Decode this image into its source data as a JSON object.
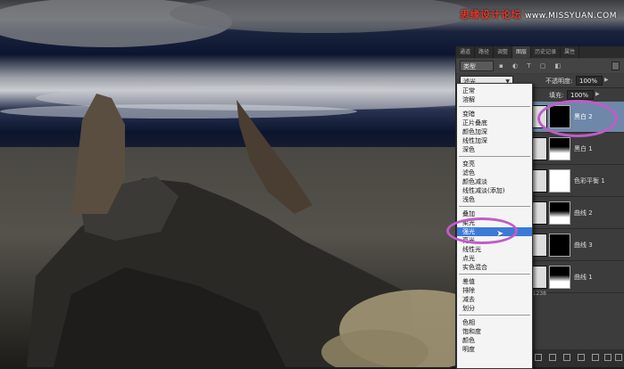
{
  "watermark": {
    "text": "思缘设计论坛",
    "url": "www.MISSYUAN.COM"
  },
  "panel": {
    "tabs": [
      "通道",
      "路径",
      "调整",
      "图层",
      "历史记录",
      "属性"
    ],
    "active_tab_index": 3,
    "filter": {
      "value": "类型"
    },
    "blend_mode": {
      "value": "滤光"
    },
    "opacity": {
      "label": "不透明度:",
      "value": "100%"
    },
    "fill": {
      "label": "填充:",
      "value": "100%"
    },
    "layers": [
      {
        "name": "黑白 2",
        "selected": true
      },
      {
        "name": "黑白 1",
        "selected": false
      },
      {
        "name": "色彩平衡 1",
        "selected": false
      },
      {
        "name": "曲线 2",
        "selected": false
      },
      {
        "name": "曲线 3",
        "selected": false
      },
      {
        "name": "曲线 1",
        "selected": false
      }
    ],
    "extra_text": "5 1238"
  },
  "blend_menu": {
    "groups": [
      [
        "正常",
        "溶解"
      ],
      [
        "变暗",
        "正片叠底",
        "颜色加深",
        "线性加深",
        "深色"
      ],
      [
        "变亮",
        "滤色",
        "颜色减淡",
        "线性减淡(添加)",
        "浅色"
      ],
      [
        "叠加",
        "柔光",
        "强光",
        "亮光",
        "线性光",
        "点光",
        "实色混合"
      ],
      [
        "差值",
        "排除",
        "减去",
        "划分"
      ],
      [
        "色相",
        "饱和度",
        "颜色",
        "明度"
      ]
    ],
    "highlighted": "强光"
  },
  "colors": {
    "highlight": "#3b7ad9",
    "selected_layer": "#6f87a8",
    "annotation": "#c05cc8",
    "watermark": "#e03a2a"
  }
}
